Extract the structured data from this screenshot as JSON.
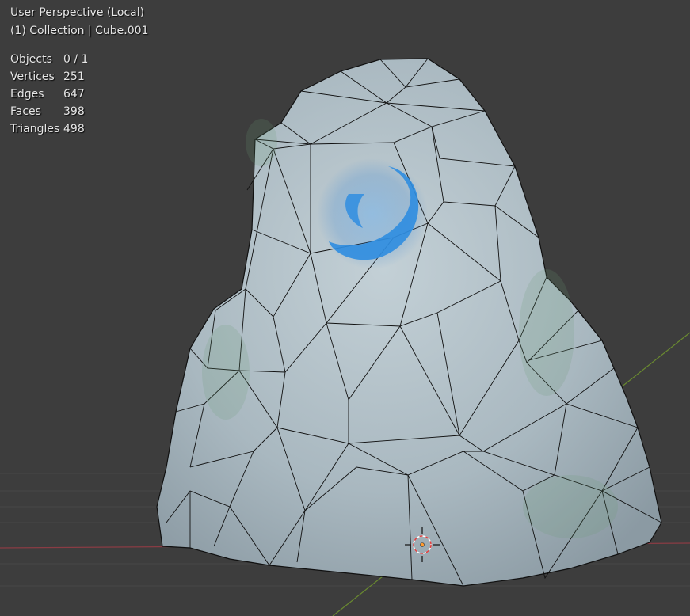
{
  "viewport": {
    "view_label": "User Perspective (Local)",
    "collection_label": "(1) Collection | Cube.001"
  },
  "stats": [
    {
      "label": "Objects",
      "value": "0 / 1"
    },
    {
      "label": "Vertices",
      "value": "251"
    },
    {
      "label": "Edges",
      "value": "647"
    },
    {
      "label": "Faces",
      "value": "398"
    },
    {
      "label": "Triangles",
      "value": "498"
    }
  ],
  "colors": {
    "background": "#3d3d3d",
    "grid_line": "#474747",
    "x_axis": "#8a3c44",
    "y_axis": "#6a8a30",
    "mesh_fill": "#a9b8c0",
    "mesh_edge": "#111111",
    "rune_glow": "#2f8de0",
    "cursor_red": "#e04040"
  },
  "icons": {
    "cursor": "3d-cursor-icon"
  }
}
